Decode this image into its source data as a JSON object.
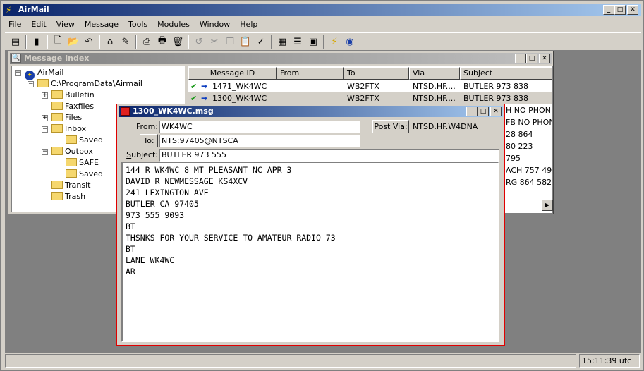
{
  "app": {
    "title": "AirMail",
    "menu": [
      "File",
      "Edit",
      "View",
      "Message",
      "Tools",
      "Modules",
      "Window",
      "Help"
    ],
    "toolbar_icons": [
      "folder-tree-icon",
      "book-icon",
      "new-message-icon",
      "open-folder-icon",
      "reply-icon",
      "trash-can-icon",
      "edit-icon",
      "print-preview-icon",
      "print-icon",
      "delete-icon",
      "undo-icon",
      "cut-icon",
      "copy-icon",
      "paste-icon",
      "spellcheck-icon",
      "index-icon",
      "list-icon",
      "window-icon",
      "lightning-icon",
      "globe-icon"
    ]
  },
  "index_window": {
    "title": "Message Index",
    "tree": [
      {
        "label": "AirMail",
        "icon": "globe-icon",
        "level": 0,
        "expander": "−"
      },
      {
        "label": "C:\\ProgramData\\Airmail",
        "icon": "folder-icon",
        "level": 1,
        "expander": "−"
      },
      {
        "label": "Bulletin",
        "icon": "folder-icon",
        "level": 2,
        "expander": "+"
      },
      {
        "label": "Faxfiles",
        "icon": "folder-icon",
        "level": 2,
        "expander": ""
      },
      {
        "label": "Files",
        "icon": "folder-icon",
        "level": 2,
        "expander": "+"
      },
      {
        "label": "Inbox",
        "icon": "folder-icon",
        "level": 2,
        "expander": "−"
      },
      {
        "label": "Saved",
        "icon": "folder-icon",
        "level": 3,
        "expander": ""
      },
      {
        "label": "Outbox",
        "icon": "folder-icon",
        "level": 2,
        "expander": "−"
      },
      {
        "label": "SAFE",
        "icon": "folder-icon",
        "level": 3,
        "expander": ""
      },
      {
        "label": "Saved",
        "icon": "folder-icon",
        "level": 3,
        "expander": ""
      },
      {
        "label": "Transit",
        "icon": "folder-icon",
        "level": 2,
        "expander": ""
      },
      {
        "label": "Trash",
        "icon": "folder-icon",
        "level": 2,
        "expander": ""
      }
    ],
    "columns": [
      "Message ID",
      "From",
      "To",
      "Via",
      "Subject"
    ],
    "rows": [
      {
        "id": "1471_WK4WC",
        "from": "",
        "to": "WB2FTX",
        "via": "NTSD.HF....",
        "subject": "BUTLER 973 838"
      },
      {
        "id": "1300_WK4WC",
        "from": "",
        "to": "WB2FTX",
        "via": "NTSD.HF....",
        "subject": "BUTLER 973 838"
      }
    ],
    "partial_subjects": [
      "H NO PHONE",
      "FB NO PHONE",
      "28 864",
      "80 223",
      "795",
      "ACH 757 493",
      "RG 864 582"
    ]
  },
  "message_window": {
    "title": "1300_WK4WC.msg",
    "from_label": "From:",
    "from_value": "WK4WC",
    "to_button": "To:",
    "to_value": "NTS:97405@NTSCA",
    "subject_label": "Subject:",
    "subject_value": "BUTLER 973 555",
    "post_via_button": "Post Via:",
    "post_via_value": "NTSD.HF.W4DNA",
    "body_lines": [
      "144 R WK4WC 8 MT PLEASANT NC APR 3",
      "DAVID R NEWMESSAGE KS4XCV",
      "241 LEXINGTON AVE",
      "BUTLER CA 97405",
      "973 555 9093",
      "BT",
      "THSNKS FOR YOUR SERVICE TO AMATEUR RADIO 73",
      "BT",
      "LANE WK4WC",
      "AR"
    ]
  },
  "status": {
    "time": "15:11:39 utc"
  }
}
